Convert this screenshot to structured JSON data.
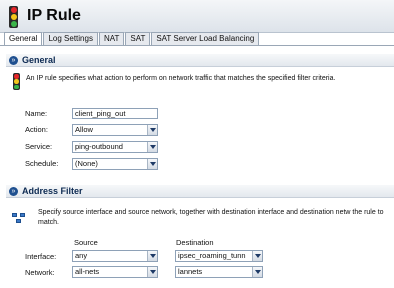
{
  "page": {
    "title": "IP Rule"
  },
  "tabs": [
    {
      "label": "General",
      "active": true
    },
    {
      "label": "Log Settings"
    },
    {
      "label": "NAT"
    },
    {
      "label": "SAT"
    },
    {
      "label": "SAT Server Load Balancing"
    }
  ],
  "general": {
    "title": "General",
    "description": "An IP rule specifies what action to perform on network traffic that matches the specified filter criteria.",
    "fields": {
      "name": {
        "label": "Name:",
        "value": "client_ping_out"
      },
      "action": {
        "label": "Action:",
        "value": "Allow"
      },
      "service": {
        "label": "Service:",
        "value": "ping-outbound"
      },
      "schedule": {
        "label": "Schedule:",
        "value": "(None)"
      }
    }
  },
  "address_filter": {
    "title": "Address Filter",
    "description": "Specify source interface and source network, together with destination interface and destination netw the rule to match.",
    "source_header": "Source",
    "destination_header": "Destination",
    "interface": {
      "label": "Interface:",
      "source": "any",
      "destination": "ipsec_roaming_tunn"
    },
    "network": {
      "label": "Network:",
      "source": "all-nets",
      "destination": "lannets"
    }
  },
  "colors": {
    "section_title": "#0d2a52",
    "accent": "#1e4f8f"
  }
}
